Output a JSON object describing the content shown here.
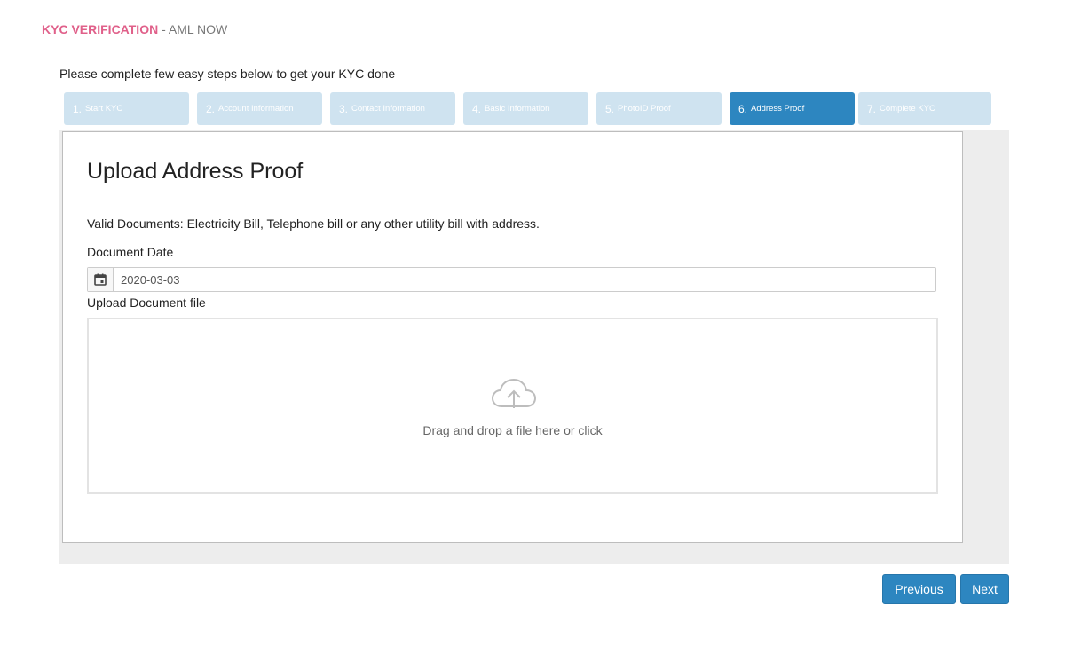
{
  "header": {
    "title": "KYC VERIFICATION",
    "separator": " - ",
    "subtitle": "AML NOW"
  },
  "intro_text": "Please complete few easy steps below to get your KYC done",
  "steps": [
    {
      "num": "1.",
      "label": "Start KYC",
      "active": false
    },
    {
      "num": "2.",
      "label": "Account Information",
      "active": false
    },
    {
      "num": "3.",
      "label": "Contact Information",
      "active": false
    },
    {
      "num": "4.",
      "label": "Basic Information",
      "active": false
    },
    {
      "num": "5.",
      "label": "PhotoID Proof",
      "active": false
    },
    {
      "num": "6.",
      "label": "Address Proof",
      "active": true
    },
    {
      "num": "7.",
      "label": "Complete KYC",
      "active": false
    }
  ],
  "panel": {
    "title": "Upload Address Proof",
    "valid_docs": "Valid Documents: Electricity Bill, Telephone bill or any other utility bill with address.",
    "date_label": "Document Date",
    "date_value": "2020-03-03",
    "date_icon": "calendar-icon",
    "upload_label": "Upload Document file",
    "dropzone_icon": "cloud-upload-icon",
    "dropzone_text": "Drag and drop a file here or click"
  },
  "buttons": {
    "previous": "Previous",
    "next": "Next"
  },
  "colors": {
    "brand": "#e0608a",
    "primary": "#2d86c0",
    "step_inactive": "#cfe3f0",
    "content_bg": "#ededed"
  }
}
